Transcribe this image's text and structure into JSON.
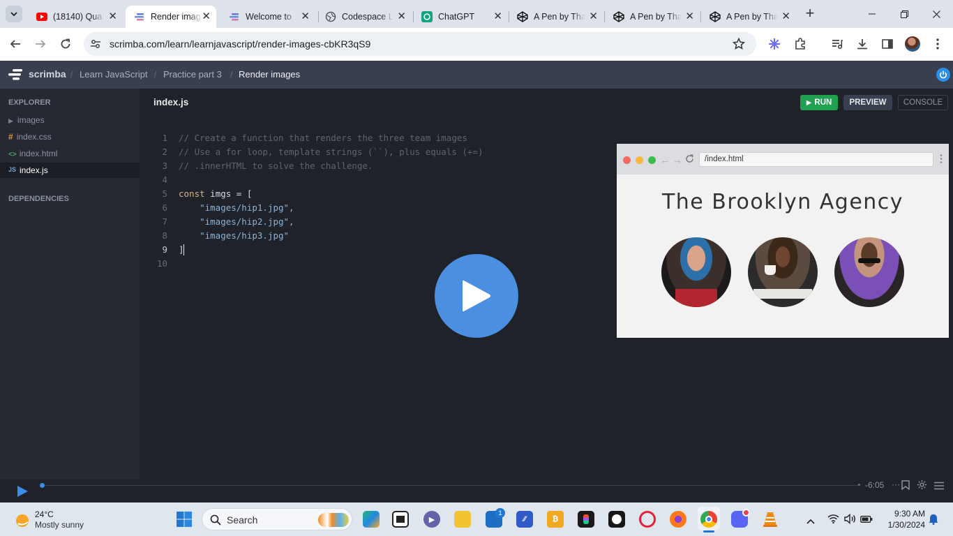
{
  "browser": {
    "tabs": [
      {
        "title": "(18140) Qua",
        "icon": "youtube-icon"
      },
      {
        "title": "Render imag",
        "icon": "scrimba-icon"
      },
      {
        "title": "Welcome to",
        "icon": "scrimba-icon"
      },
      {
        "title": "Codespace L",
        "icon": "globe-icon"
      },
      {
        "title": "ChatGPT",
        "icon": "chatgpt-icon"
      },
      {
        "title": "A Pen by Tha",
        "icon": "codepen-icon"
      },
      {
        "title": "A Pen by Tha",
        "icon": "codepen-icon"
      },
      {
        "title": "A Pen by Tha",
        "icon": "codepen-icon"
      }
    ],
    "new_tab": "+",
    "url": "scrimba.com/learn/learnjavascript/render-images-cbKR3qS9"
  },
  "scrimba": {
    "logo": "scrimba",
    "breadcrumbs": [
      "Learn JavaScript",
      "Practice part 3",
      "Render images"
    ],
    "sidebar": {
      "explorer_title": "EXPLORER",
      "items": [
        {
          "prefix": "▶",
          "label": "images",
          "color": "#8b92a0"
        },
        {
          "prefix": "#",
          "label": "index.css",
          "color": "#d89b3c"
        },
        {
          "prefix": "<>",
          "label": "index.html",
          "color": "#4fa563"
        },
        {
          "prefix": "JS",
          "label": "index.js",
          "color": "#6ea0d8"
        }
      ],
      "dependencies_title": "DEPENDENCIES"
    },
    "editor": {
      "filename": "index.js",
      "run_label": "RUN",
      "preview_label": "PREVIEW",
      "console_label": "CONSOLE",
      "line_numbers": [
        "1",
        "2",
        "3",
        "4",
        "5",
        "6",
        "7",
        "8",
        "9",
        "10"
      ],
      "lines": [
        "// Create a function that renders the three team images",
        "// Use a for loop, template strings (``), plus equals (+=)",
        "// .innerHTML to solve the challenge.",
        "",
        "const imgs = [",
        "    \"images/hip1.jpg\",",
        "    \"images/hip2.jpg\",",
        "    \"images/hip3.jpg\"",
        "]",
        ""
      ]
    },
    "preview": {
      "path": "/index.html",
      "heading": "The Brooklyn Agency"
    },
    "playback": {
      "time_left": "-6:05",
      "progress": 0.0
    }
  },
  "taskbar": {
    "weather_temp": "24°C",
    "weather_desc": "Mostly sunny",
    "search_placeholder": "Search",
    "store_badge": "1",
    "time": "9:30 AM",
    "date": "1/30/2024"
  }
}
